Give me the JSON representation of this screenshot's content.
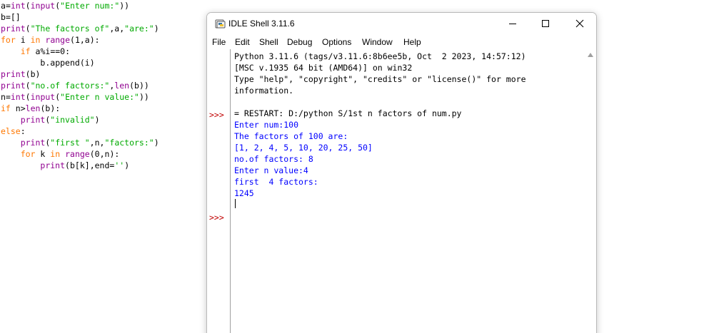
{
  "editor": {
    "lines": [
      "a=int(input(\"Enter num:\"))",
      "b=[]",
      "print(\"The factors of\",a,\"are:\")",
      "for i in range(1,a):",
      "    if a%i==0:",
      "        b.append(i)",
      "print(b)",
      "print(\"no.of factors:\",len(b))",
      "n=int(input(\"Enter n value:\"))",
      "if n>len(b):",
      "    print(\"invalid\")",
      "else:",
      "    print(\"first \",n,\"factors:\")",
      "    for k in range(0,n):",
      "        print(b[k],end='')"
    ]
  },
  "window": {
    "title": "IDLE Shell 3.11.6",
    "icon": "python-idle-icon",
    "controls": [
      "minimize-icon",
      "maximize-icon",
      "close-icon"
    ]
  },
  "menu": {
    "items": [
      "File",
      "Edit",
      "Shell",
      "Debug",
      "Options",
      "Window",
      "Help"
    ]
  },
  "shell": {
    "prompt": ">>>",
    "lines": [
      {
        "text": "Python 3.11.6 (tags/v3.11.6:8b6ee5b, Oct  2 2023, 14:57:12)",
        "color": "#000000"
      },
      {
        "text": "[MSC v.1935 64 bit (AMD64)] on win32",
        "color": "#000000"
      },
      {
        "text": "Type \"help\", \"copyright\", \"credits\" or \"license()\" for more",
        "color": "#000000"
      },
      {
        "text": "information.",
        "color": "#000000"
      },
      {
        "text": "",
        "color": "#000000"
      },
      {
        "text": "= RESTART: D:/python S/1st n factors of num.py",
        "color": "#000000"
      },
      {
        "text": "Enter num:100",
        "color": "#0000ff"
      },
      {
        "text": "The factors of 100 are:",
        "color": "#0000ff"
      },
      {
        "text": "[1, 2, 4, 5, 10, 20, 25, 50]",
        "color": "#0000ff"
      },
      {
        "text": "no.of factors: 8",
        "color": "#0000ff"
      },
      {
        "text": "Enter n value:4",
        "color": "#0000ff"
      },
      {
        "text": "first  4 factors:",
        "color": "#0000ff"
      },
      {
        "text": "1245",
        "color": "#0000ff"
      }
    ]
  },
  "colors": {
    "keyword": "#ff7700",
    "builtin": "#900090",
    "string": "#00aa00",
    "prompt": "#c00000",
    "stdout": "#0000ff"
  }
}
